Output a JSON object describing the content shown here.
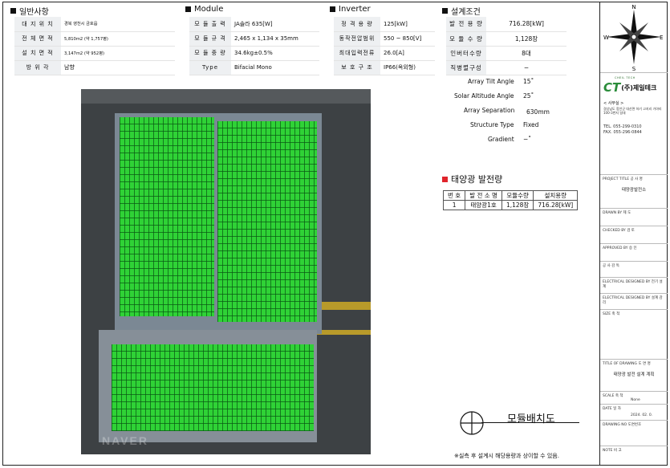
{
  "general": {
    "title": "일반사항",
    "rows": [
      {
        "key": "대 지 위 치",
        "value": "경북 영천시 금호읍"
      },
      {
        "key": "전 체 면 적",
        "value": "5,810m2 (약 1,757평)"
      },
      {
        "key": "설 치 면 적",
        "value": "3,147m2 (약 952평)"
      },
      {
        "key": "방 위 각",
        "value": "남향"
      }
    ]
  },
  "module": {
    "title": "Module",
    "rows": [
      {
        "key": "모 듈 출 력",
        "value": "JA솔라 635[W]"
      },
      {
        "key": "모 듈 규 격",
        "value": "2,465 x 1,134 x 35mm"
      },
      {
        "key": "모 듈 중 량",
        "value": "34.6kg±0.5%"
      },
      {
        "key": "Type",
        "value": "Bifacial Mono"
      }
    ]
  },
  "inverter": {
    "title": "Inverter",
    "rows": [
      {
        "key": "정 격 용 량",
        "value": "125[kW]"
      },
      {
        "key": "동작전압범위",
        "value": "550 ~ 850[V]"
      },
      {
        "key": "최대입력전류",
        "value": "26.0[A]"
      },
      {
        "key": "보 호 구 조",
        "value": "IP66(옥외형)"
      }
    ]
  },
  "design": {
    "title": "설계조건",
    "rows": [
      {
        "key": "발 전 용 량",
        "value": "716.28[kW]"
      },
      {
        "key": "모 듈 수 량",
        "value": "1,128장"
      },
      {
        "key": "인버터수량",
        "value": "8대"
      },
      {
        "key": "직병렬구성",
        "value": "−"
      }
    ],
    "params": [
      {
        "label": "Array Tilt Angle",
        "value": "15˚"
      },
      {
        "label": "Solar Altitude Angle",
        "value": "25˚"
      },
      {
        "label": "Array Separation",
        "value": "630mm"
      },
      {
        "label": "Structure Type",
        "value": "Fixed"
      },
      {
        "label": "Gradient",
        "value": "−˚"
      }
    ]
  },
  "generation": {
    "title": "태양광 발전량",
    "headers": [
      "번 호",
      "발 전 소 명",
      "모듈수량",
      "설치용량"
    ],
    "rows": [
      {
        "no": "1",
        "name": "태양광1호",
        "modules": "1,128장",
        "capacity": "716.28[kW]"
      }
    ]
  },
  "aerial": {
    "watermark": "NAVER"
  },
  "drawing_title": "모듈배치도",
  "note": "※실측 후 설계시 해당용량과 상이할 수 있음.",
  "compass": {
    "n": "N",
    "s": "S",
    "e": "E",
    "w": "W"
  },
  "company": {
    "logo": "CT",
    "name": "(주)제일테크",
    "small_caps": "CHEIL TECH",
    "office_label": "< 사무실 >",
    "address": "경상남도 함안군 대산면 하기 고지리 가야리 100-3번지 일대",
    "tel": "TEL. 055-299-0310",
    "fax": "FAX. 055-296-0844"
  },
  "title_block": [
    {
      "label": "PROJECT TITLE 공 사 명",
      "value": "태양광발전소"
    },
    {
      "label": "DRAWN BY 제 도",
      "value": ""
    },
    {
      "label": "CHECKED BY 검 토",
      "value": ""
    },
    {
      "label": "APPROVED BY 승 인",
      "value": ""
    },
    {
      "label": "공 사 감 독",
      "value": ""
    },
    {
      "label": "ELECTRICAL DESIGNED BY 전기 설계",
      "value": ""
    },
    {
      "label": "ELECTRICAL DESIGNED BY 설계 감리",
      "value": ""
    },
    {
      "label": "SIZE 축 척",
      "value": ""
    },
    {
      "label": "TITLE OF DRAWING 도 면 명",
      "value": "태양광 발전 설계 계획"
    },
    {
      "label": "SCALE 축 척",
      "value": "None"
    },
    {
      "label": "DATE 일 자",
      "value": "2024. 02. 0."
    },
    {
      "label": "DRAWING NO 도면번호",
      "value": ""
    },
    {
      "label": "NOTE 비 고",
      "value": ""
    }
  ],
  "colors": {
    "panel_green": "#2fd236",
    "accent_red": "#e0242b",
    "key_bg": "#eef0f2"
  }
}
